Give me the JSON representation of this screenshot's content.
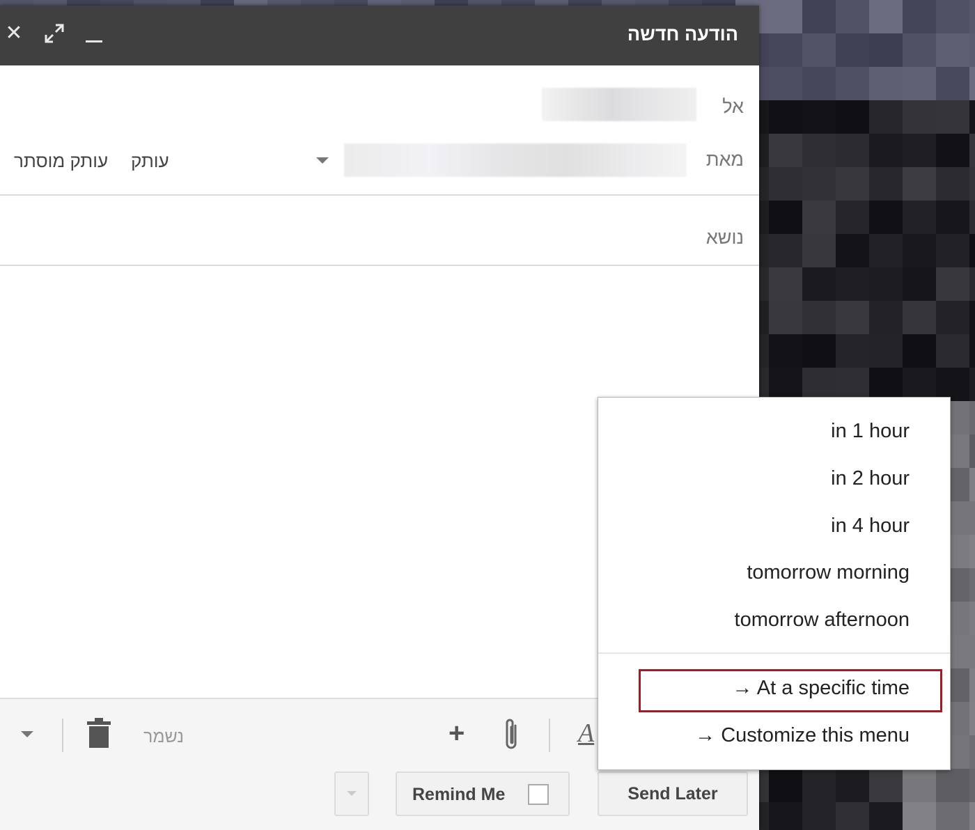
{
  "compose": {
    "title": "הודעה חדשה",
    "to_label": "אל",
    "from_label": "מאת",
    "subject_label": "נושא",
    "cc_label": "עותק",
    "bcc_label": "עותק מוסתר",
    "saved_status": "נשמר"
  },
  "titlebar_icons": [
    "close-icon",
    "expand-icon",
    "minimize-icon"
  ],
  "toolbar": {
    "icons": [
      "more-options-chevron-icon",
      "trash-icon",
      "plus-icon",
      "attach-icon",
      "text-format-icon"
    ],
    "remind_me_label": "Remind Me",
    "send_later_label": "Send Later"
  },
  "send_later_menu": {
    "items": [
      "in 1 hour",
      "in 2 hour",
      "in 4 hour",
      "tomorrow morning",
      "tomorrow afternoon",
      "→ At a specific time",
      "→ Customize this menu"
    ]
  },
  "colors": {
    "titlebar": "#404040",
    "highlight": "#a01c24",
    "toolbar_bg": "#f5f5f5"
  }
}
